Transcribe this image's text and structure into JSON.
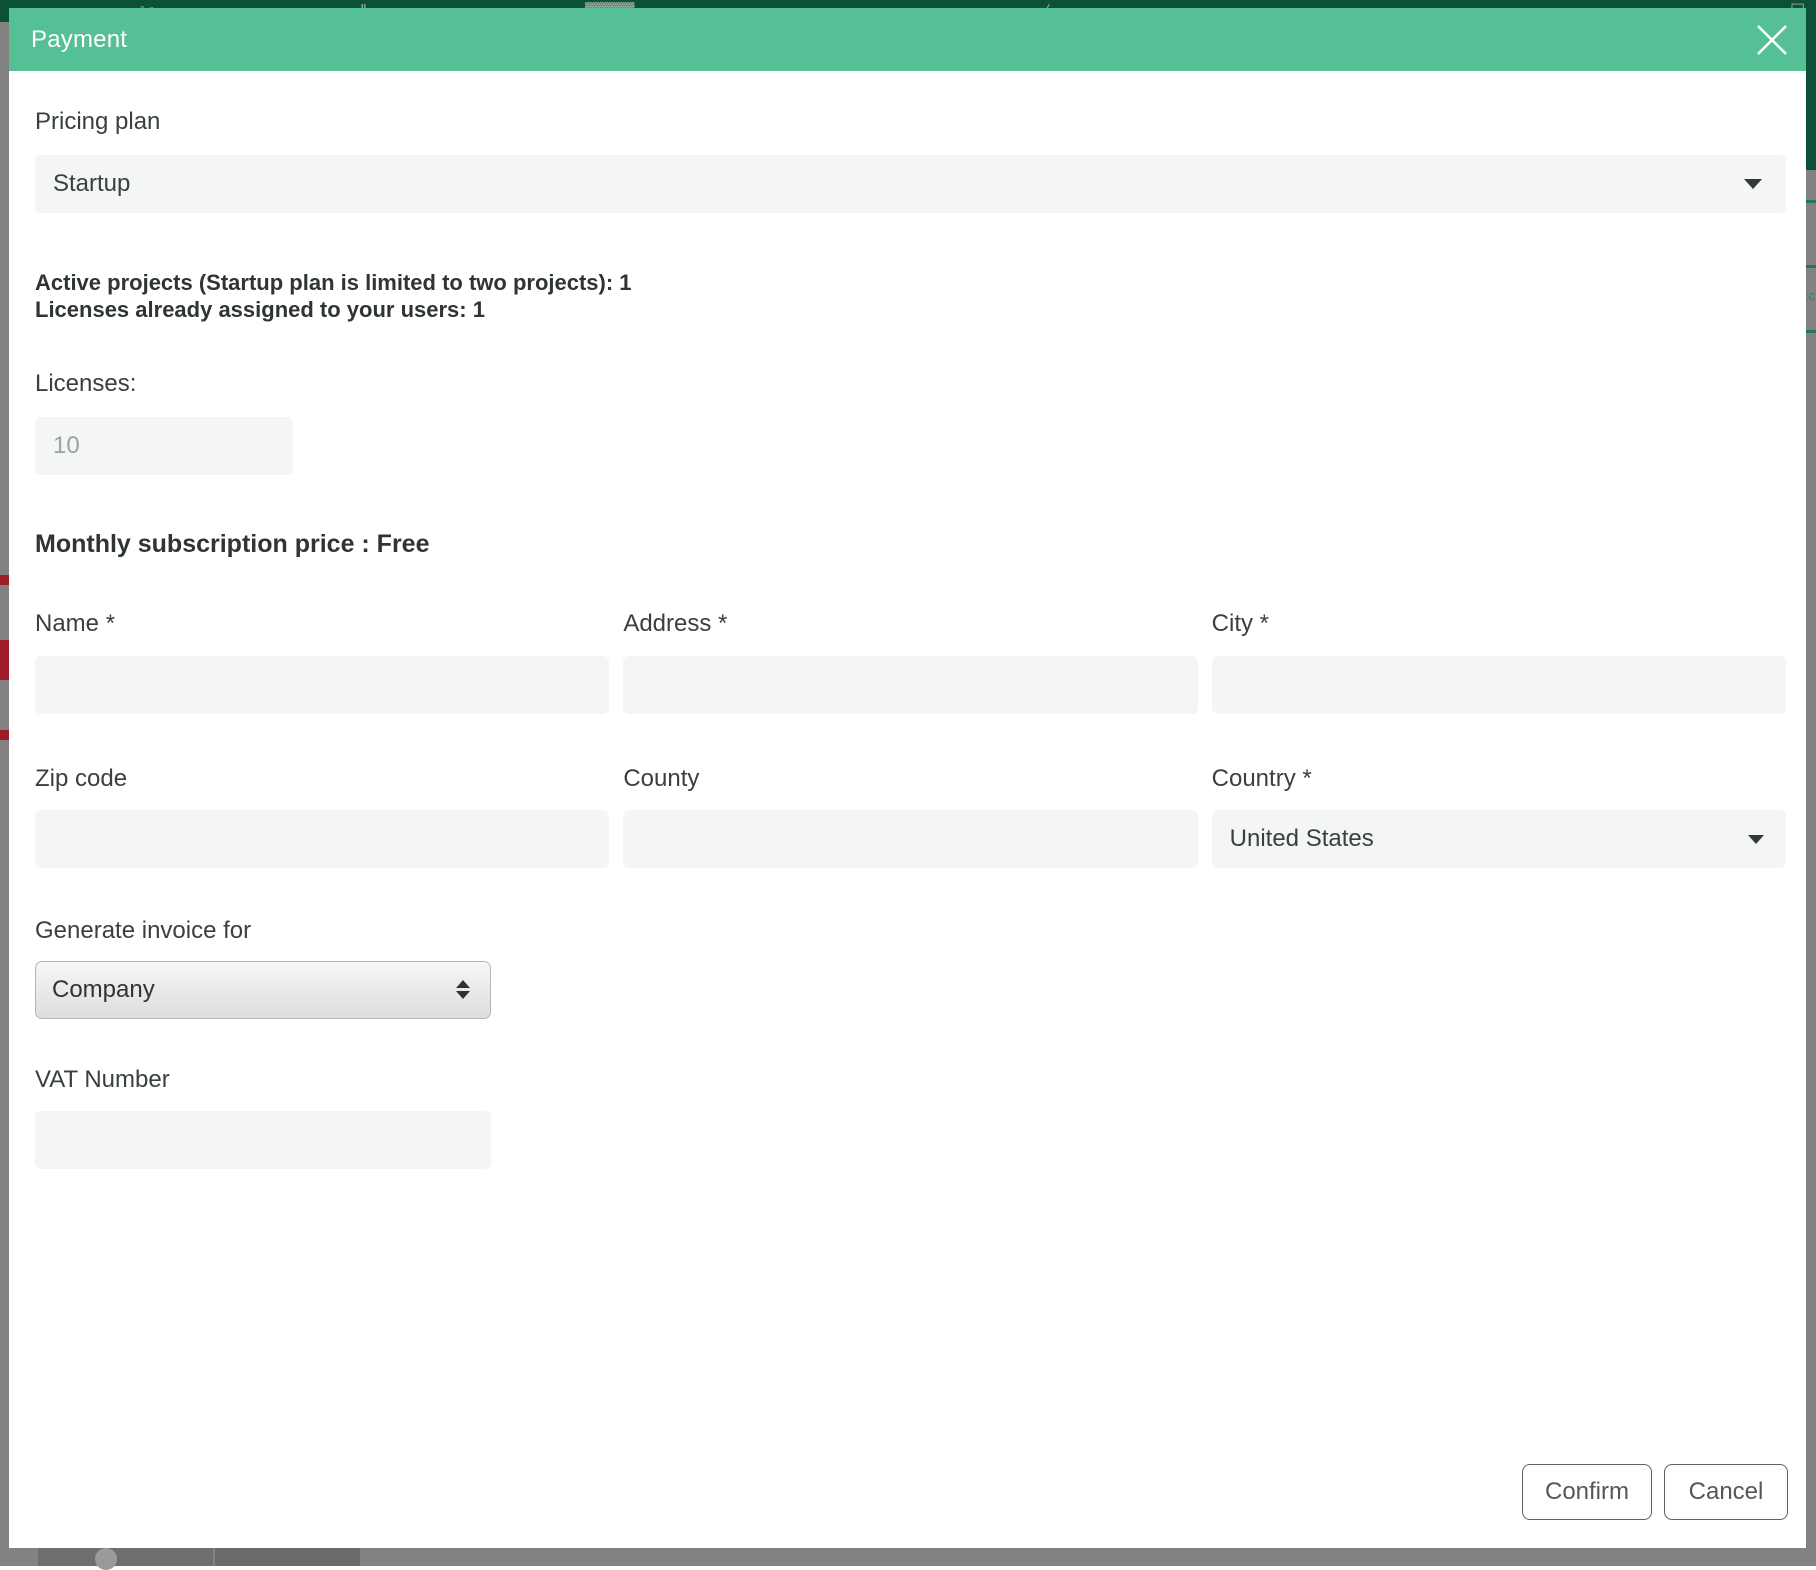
{
  "modal": {
    "title": "Payment",
    "close_icon": "close-icon"
  },
  "pricing_plan": {
    "label": "Pricing plan",
    "selected": "Startup",
    "caret_icon": "chevron-down-icon"
  },
  "notice": {
    "line1": "Active projects (Startup plan is limited to two projects): 1",
    "line2": "Licenses already assigned to your users: 1"
  },
  "licenses": {
    "label": "Licenses:",
    "value": "",
    "placeholder": "10"
  },
  "price": {
    "text": "Monthly subscription price : Free"
  },
  "address_form": {
    "row1": [
      {
        "label": "Name *",
        "value": "",
        "name": "name-field"
      },
      {
        "label": "Address *",
        "value": "",
        "name": "address-field"
      },
      {
        "label": "City *",
        "value": "",
        "name": "city-field"
      }
    ],
    "row2": [
      {
        "label": "Zip code",
        "value": "",
        "name": "zip-code-field"
      },
      {
        "label": "County",
        "value": "",
        "name": "county-field"
      }
    ],
    "country": {
      "label": "Country *",
      "selected": "United States",
      "caret_icon": "chevron-down-icon"
    }
  },
  "invoice": {
    "label": "Generate invoice for",
    "selected": "Company",
    "spinner_icon": "updown-arrows-icon"
  },
  "vat": {
    "label": "VAT Number",
    "value": ""
  },
  "footer": {
    "confirm_label": "Confirm",
    "cancel_label": "Cancel"
  },
  "colors": {
    "header_green": "#55bf95",
    "page_green": "#0c5137",
    "input_bg": "#f4f6f6",
    "text": "#3a4042"
  },
  "background": {
    "glyphs": [
      "✂",
      "‖",
      "▓▓▓▓",
      "◱",
      "∕",
      "☐"
    ],
    "right_text": ":c"
  }
}
